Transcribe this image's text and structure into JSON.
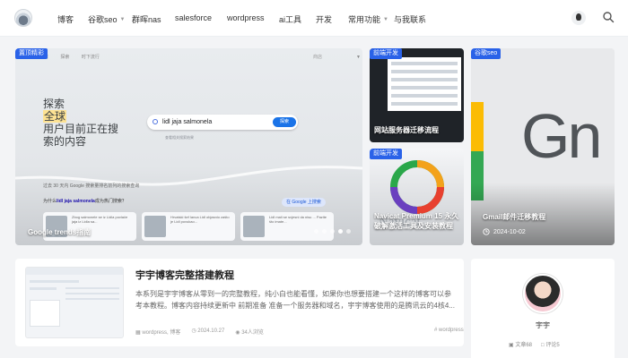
{
  "header": {
    "nav": [
      {
        "label": "博客",
        "dropdown": false
      },
      {
        "label": "谷歌seo",
        "dropdown": true
      },
      {
        "label": "群晖nas",
        "dropdown": false
      },
      {
        "label": "salesforce",
        "dropdown": false
      },
      {
        "label": "wordpress",
        "dropdown": false
      },
      {
        "label": "ai工具",
        "dropdown": false
      },
      {
        "label": "开发",
        "dropdown": false
      },
      {
        "label": "常用功能",
        "dropdown": true
      },
      {
        "label": "与我联系",
        "dropdown": false
      }
    ],
    "icons": [
      "site-logo",
      "theme-toggle-icon",
      "search-icon"
    ]
  },
  "slider": {
    "category": "置顶精彩",
    "title": "Google trends指南",
    "active_slide": 4,
    "slide_count": 5,
    "screenshot": {
      "tabs": [
        "探索",
        "时下流行"
      ],
      "tab_left": "首",
      "shop_label": "商店",
      "headline_pre": "探索",
      "headline_hl": "全球",
      "headline_post1": "用户目前正在搜",
      "headline_post2": "索的内容",
      "search_value": "lidl jaja salmonela",
      "search_button": "探索",
      "search_sub": "查看相关搜索结果",
      "stat_line": "过去 30 天内 Google 搜索量排名前列的搜索查询",
      "question_pre": "为什么",
      "question_term": "lidl jaja salmonela",
      "question_post": "成为热门搜索？",
      "pill": "在 Google 上搜索",
      "cards": [
        "Zbog salmonele se iz Lidla povlače jaja iz Lidla sa...",
        "Hrvatski šef lanca Lidl objasnio zašto je Lidl povukao...",
        "Lidl mali se svjesni da nisu ... Pazite što imate..."
      ]
    }
  },
  "cards": [
    {
      "category": "前端开发",
      "title": "网站服务器迁移流程"
    },
    {
      "category": "前端开发",
      "title": "Navicat Premium 15 永久破解激活工具及安装教程",
      "image_word": "Navicat"
    },
    {
      "category": "谷歌seo",
      "title": "Gmail邮件迁移教程",
      "date": "2024-10-02",
      "image_word": "Gn"
    }
  ],
  "post": {
    "title": "宇宇博客完整搭建教程",
    "excerpt": "本系列是宇宇博客从零到一的完整教程，纯小白也能看懂，如果你也想要搭建一个这样的博客可以参考本教程。博客内容持续更新中 前期准备 准备一个服务器和域名，宇宇博客使用的是腾讯云的4核4...",
    "categories": "wordpress, 博客",
    "date": "2024.10.27",
    "views": "34人浏览",
    "tag": "wordpress"
  },
  "author": {
    "name": "宇宇",
    "articles": "文章68",
    "comments": "评论5"
  }
}
